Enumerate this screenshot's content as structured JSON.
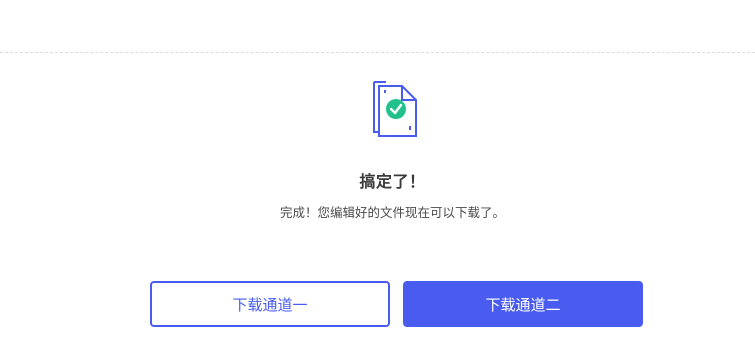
{
  "result": {
    "title": "搞定了！",
    "message": "完成！您编辑好的文件现在可以下载了。",
    "icon": "document-check-icon"
  },
  "actions": {
    "download_channel_1": "下载通道一",
    "download_channel_2": "下载通道二"
  },
  "colors": {
    "accent": "#4a5cf0",
    "success": "#22c08b",
    "divider": "#dcdcdc"
  }
}
